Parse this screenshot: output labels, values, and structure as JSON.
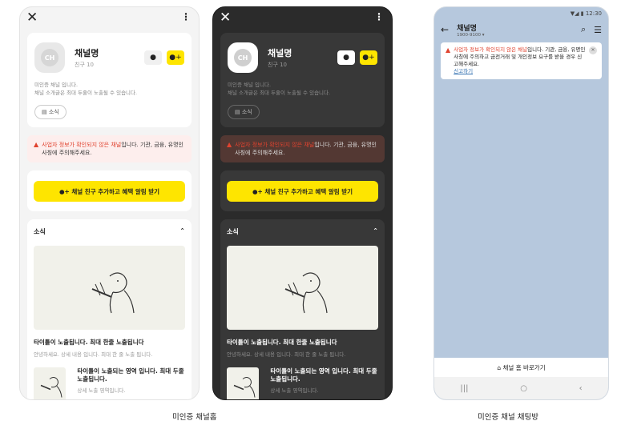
{
  "channel_home": {
    "close_icon": "close-icon",
    "more_icon": "more-icon",
    "channel_name": "채널명",
    "friends": "친구 10",
    "avatar_text": "CH",
    "desc_line1": "미인증 채널 입니다.",
    "desc_line2": "채널 소개글은 최대 두줄이 노출될 수 있습니다.",
    "news_button": "소식",
    "warning_red": "사업자 정보가 확인되지 않은 채널",
    "warning_rest": "입니다. 기관, 금융, 유명인 사칭에 주의해주세요.",
    "add_friend_button": "채널 친구 추가하고 혜택 알림 받기",
    "news_section_title": "소식",
    "post_title": "타이틀이 노출됩니다. 최대 한줄 노출됩니다",
    "post_sub": "안녕하세요. 상세 내용 입니다. 최대 한 줄 노출 됩니다.",
    "item_title": "타이틀이 노출되는 영역 입니다. 최대 두줄 노출됩니다.",
    "item_sub": "상세 노출 영역입니다."
  },
  "chat_room": {
    "status_time": "12:30",
    "channel_name": "채널명",
    "phone": "1900-9100",
    "warning_red": "사업자 정보가 확인되지 않은 채널",
    "warning_rest": "입니다. 기관, 금융, 유명인 사칭에 주의하고 금전거래 및 개인정보 요구를 받을 경우 신고해주세요.",
    "report_link": "신고하기",
    "home_shortcut": "채널 홈 바로가기"
  },
  "captions": {
    "left": "미인증 채널홈",
    "right": "미인증 채널 채팅방"
  },
  "colors": {
    "accent_yellow": "#fee500",
    "warning_red": "#e0432f"
  }
}
